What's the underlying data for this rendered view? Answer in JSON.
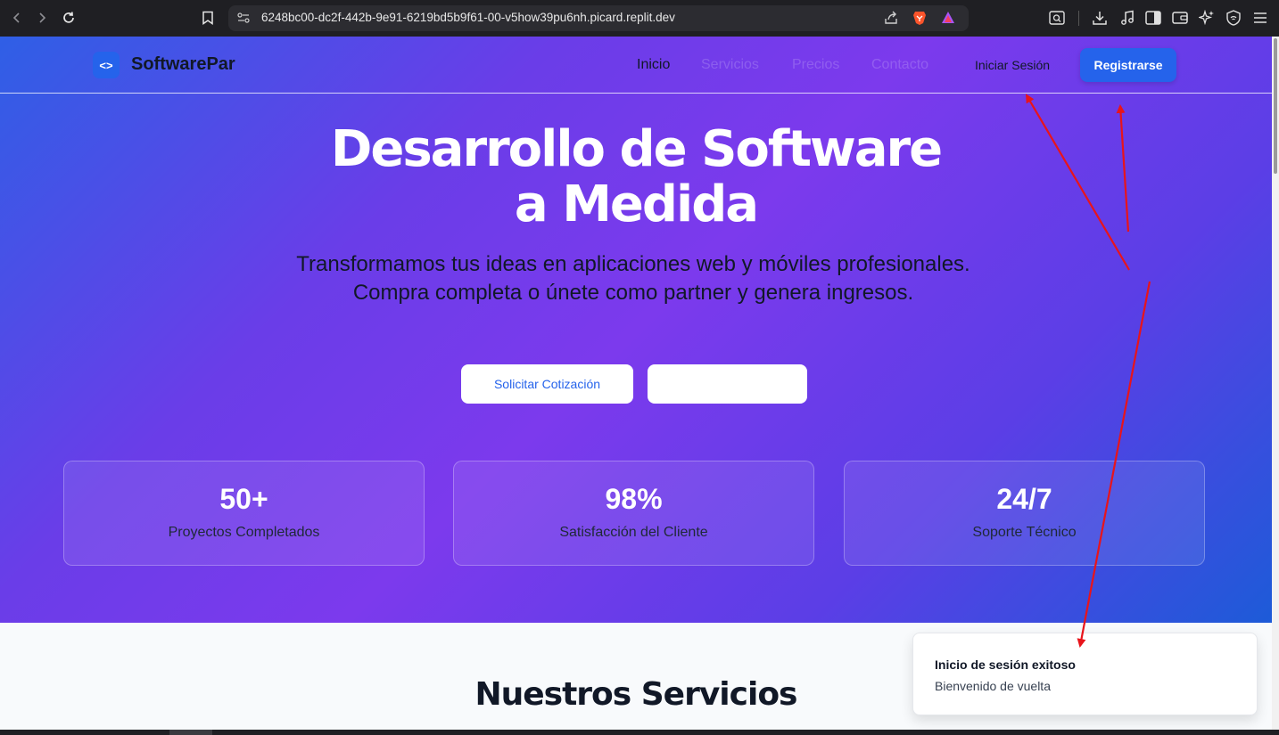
{
  "browser": {
    "url": "6248bc00-dc2f-442b-9e91-6219bd5b9f61-00-v5how39pu6nh.picard.replit.dev",
    "icons": [
      "back-icon",
      "forward-icon",
      "reload-icon",
      "bookmark-icon",
      "site-settings-icon",
      "share-icon",
      "brave-shields-icon",
      "brave-rewards-icon",
      "tab-search-icon",
      "download-icon",
      "media-icon",
      "sidebar-icon",
      "wallet-icon",
      "leo-ai-icon",
      "vpn-icon",
      "menu-icon"
    ]
  },
  "header": {
    "logo_symbol": "<>",
    "brand": "SoftwarePar",
    "nav": [
      "Inicio",
      "Servicios",
      "Precios",
      "Contacto"
    ],
    "login": "Iniciar Sesión",
    "register": "Registrarse"
  },
  "hero": {
    "title_line1": "Desarrollo de Software",
    "title_line2": "a Medida",
    "subtitle": "Transformamos tus ideas en aplicaciones web y móviles profesionales. Compra completa o únete como partner y genera ingresos.",
    "primary_button": "Solicitar Cotización",
    "secondary_button": ""
  },
  "stats": [
    {
      "value": "50+",
      "label": "Proyectos Completados"
    },
    {
      "value": "98%",
      "label": "Satisfacción del Cliente"
    },
    {
      "value": "24/7",
      "label": "Soporte Técnico"
    }
  ],
  "services": {
    "title": "Nuestros Servicios"
  },
  "toast": {
    "title": "Inicio de sesión exitoso",
    "description": "Bienvenido de vuelta"
  },
  "colors": {
    "primary": "#2563eb",
    "hero_purple": "#7c3aed",
    "annotation_red": "#e8141b"
  }
}
